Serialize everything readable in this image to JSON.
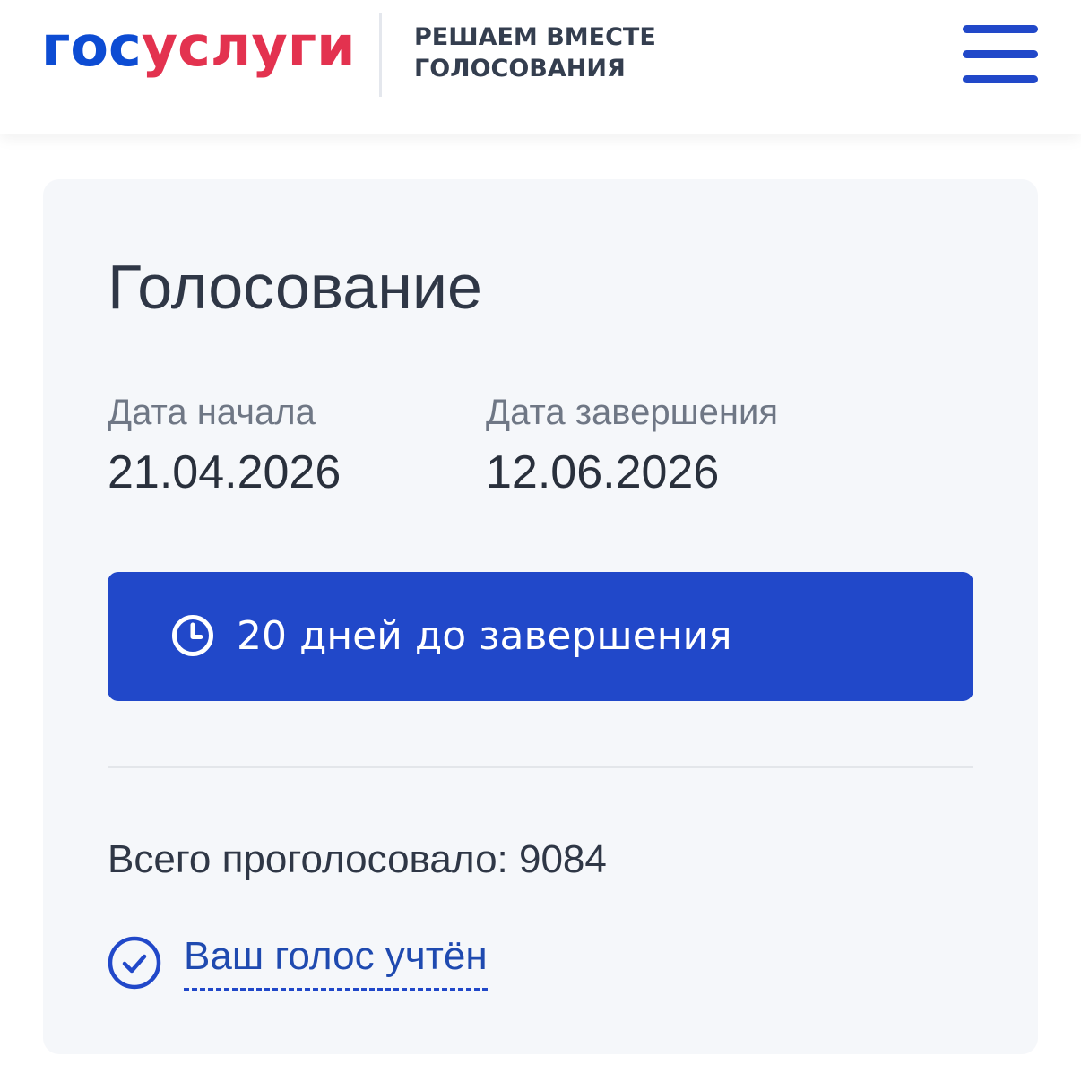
{
  "header": {
    "logo_part1": "гос",
    "logo_part2": "услуги",
    "tagline_line1": "РЕШАЕМ ВМЕСТЕ",
    "tagline_line2": "ГОЛОСОВАНИЯ",
    "menu_icon": "hamburger-menu-icon"
  },
  "card": {
    "title": "Голосование",
    "start_label": "Дата начала",
    "start_value": "21.04.2026",
    "end_label": "Дата завершения",
    "end_value": "12.06.2026",
    "countdown_icon": "clock-icon",
    "countdown_text": "20 дней до завершения",
    "total_text": "Всего проголосовало: 9084",
    "status_icon": "check-circle-icon",
    "status_text": "Ваш голос учтён"
  },
  "colors": {
    "brand_blue": "#0d4cd3",
    "brand_red": "#e3324f",
    "accent_blue": "#2148c9",
    "card_background": "#f5f7fa"
  }
}
